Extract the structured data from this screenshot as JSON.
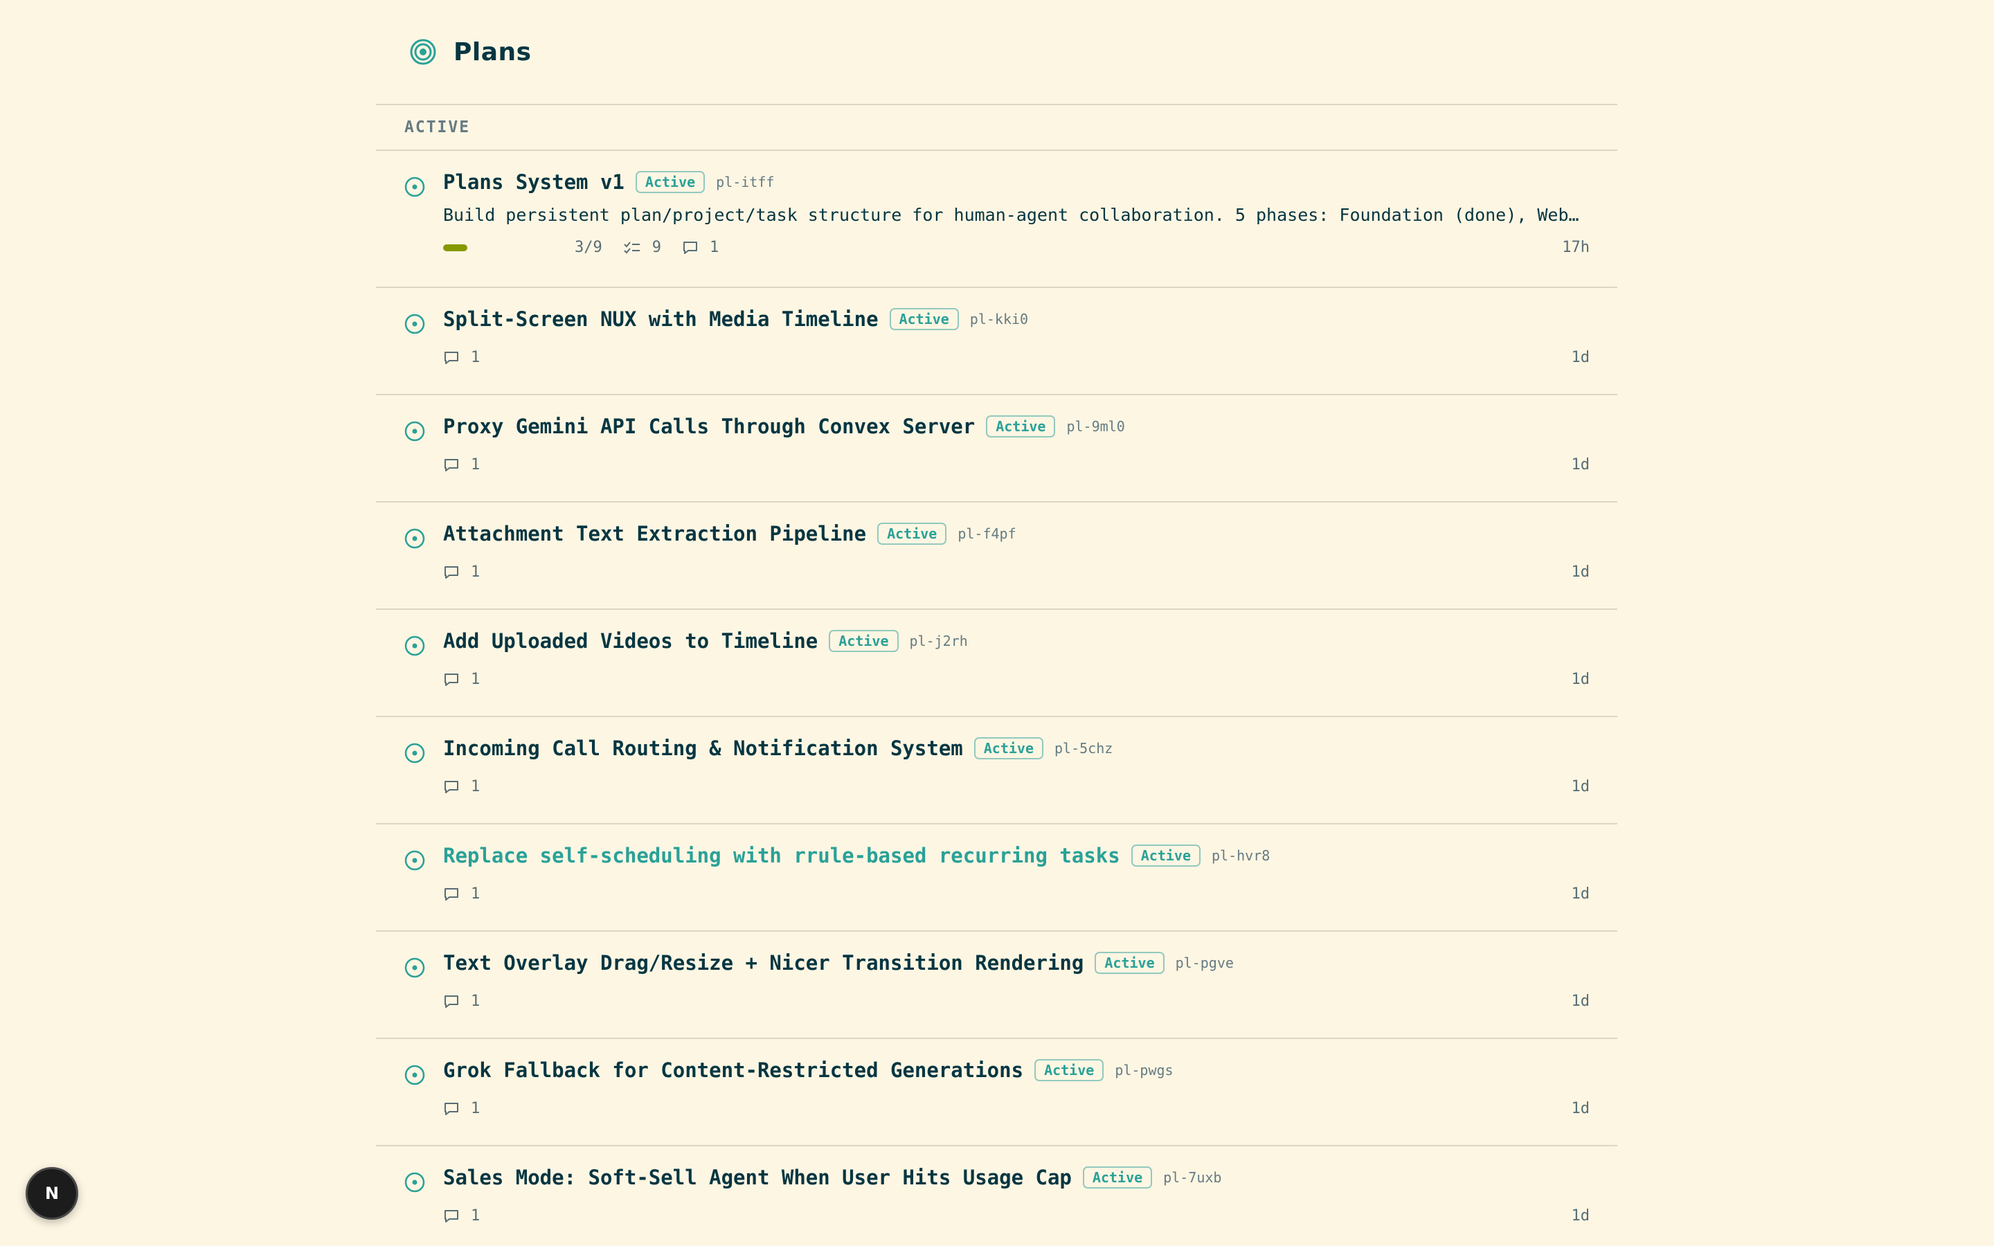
{
  "header": {
    "title": "Plans",
    "icon": "target-icon"
  },
  "section": {
    "label": "ACTIVE"
  },
  "plans": [
    {
      "title": "Plans System v1",
      "status": "Active",
      "id": "pl-itff",
      "description": "Build persistent plan/project/task structure for human-agent collaboration. 5 phases: Foundation (done), Web UI (…",
      "progress_text": "3/9",
      "progress_fraction": 0.222,
      "tasks": "9",
      "comments": "1",
      "age": "17h"
    },
    {
      "title": "Split-Screen NUX with Media Timeline",
      "status": "Active",
      "id": "pl-kki0",
      "comments": "1",
      "age": "1d"
    },
    {
      "title": "Proxy Gemini API Calls Through Convex Server",
      "status": "Active",
      "id": "pl-9ml0",
      "comments": "1",
      "age": "1d"
    },
    {
      "title": "Attachment Text Extraction Pipeline",
      "status": "Active",
      "id": "pl-f4pf",
      "comments": "1",
      "age": "1d"
    },
    {
      "title": "Add Uploaded Videos to Timeline",
      "status": "Active",
      "id": "pl-j2rh",
      "comments": "1",
      "age": "1d"
    },
    {
      "title": "Incoming Call Routing & Notification System",
      "status": "Active",
      "id": "pl-5chz",
      "comments": "1",
      "age": "1d"
    },
    {
      "title": "Replace self-scheduling with rrule-based recurring tasks",
      "status": "Active",
      "id": "pl-hvr8",
      "comments": "1",
      "age": "1d",
      "highlighted": true
    },
    {
      "title": "Text Overlay Drag/Resize + Nicer Transition Rendering",
      "status": "Active",
      "id": "pl-pgve",
      "comments": "1",
      "age": "1d"
    },
    {
      "title": "Grok Fallback for Content-Restricted Generations",
      "status": "Active",
      "id": "pl-pwgs",
      "comments": "1",
      "age": "1d"
    },
    {
      "title": "Sales Mode: Soft-Sell Agent When User Hits Usage Cap",
      "status": "Active",
      "id": "pl-7uxb",
      "comments": "1",
      "age": "1d"
    }
  ],
  "dev_badge": {
    "label": "N"
  },
  "colors": {
    "background": "#fdf6e3",
    "accent": "#2aa198",
    "progress": "#859900",
    "text": "#073642",
    "muted": "#657b83"
  }
}
